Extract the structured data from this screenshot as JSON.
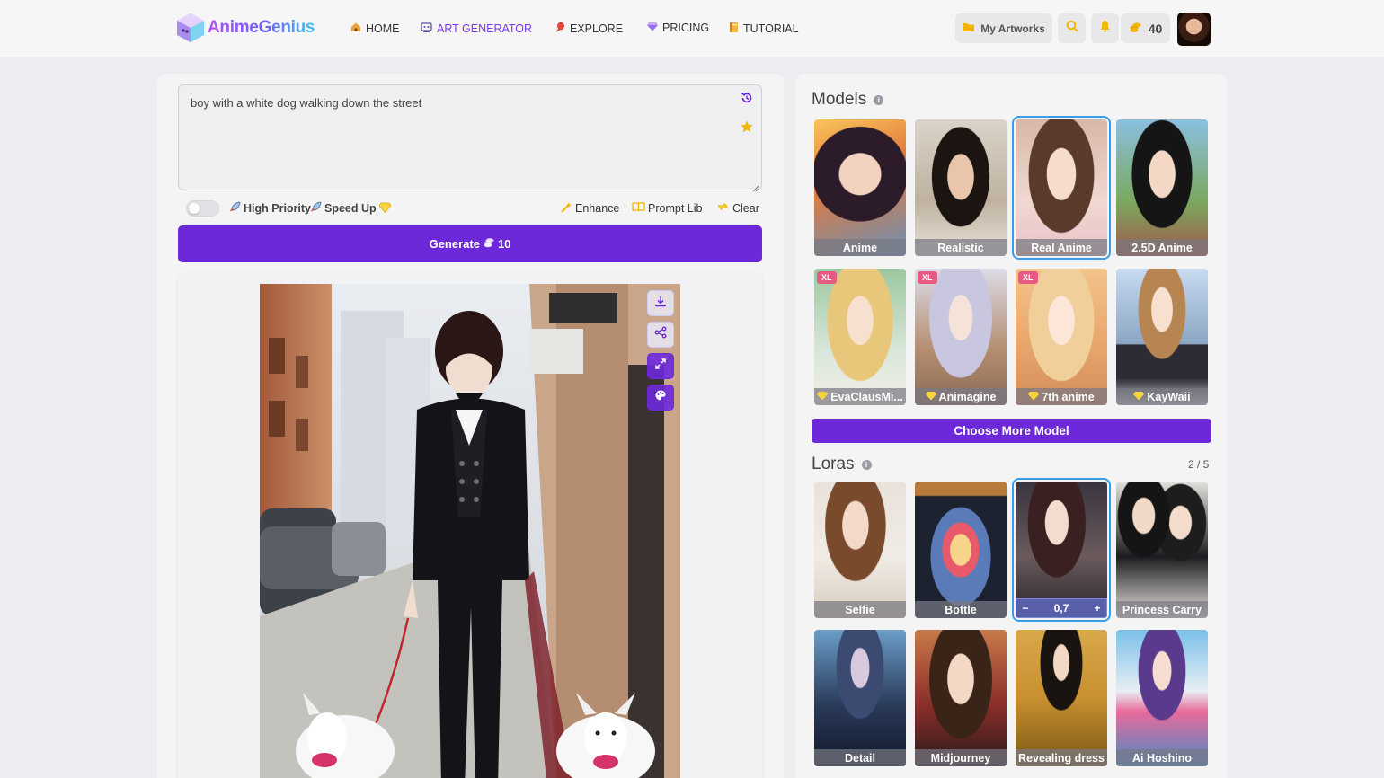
{
  "header": {
    "logo_text": "AnimeGenius",
    "nav": [
      {
        "label": "HOME",
        "icon": "home-icon"
      },
      {
        "label": "ART GENERATOR",
        "icon": "art-icon"
      },
      {
        "label": "EXPLORE",
        "icon": "explore-icon"
      },
      {
        "label": "PRICING",
        "icon": "diamond-icon"
      },
      {
        "label": "TUTORIAL",
        "icon": "book-icon"
      }
    ],
    "my_artworks": "My Artworks",
    "coins": "40"
  },
  "prompt": {
    "text": "boy with a white dog walking down the street"
  },
  "options": {
    "high_priority": "High Priority",
    "speed_up": "Speed Up",
    "enhance": "Enhance",
    "prompt_lib": "Prompt Lib",
    "clear": "Clear"
  },
  "generate": {
    "label": "Generate",
    "cost": "10"
  },
  "models": {
    "title": "Models",
    "items": [
      {
        "label": "Anime"
      },
      {
        "label": "Realistic"
      },
      {
        "label": "Real Anime"
      },
      {
        "label": "2.5D Anime"
      },
      {
        "label": "EvaClausMi...",
        "badge": "XL"
      },
      {
        "label": "Animagine",
        "badge": "XL"
      },
      {
        "label": "7th anime",
        "badge": "XL"
      },
      {
        "label": "KayWaii"
      }
    ],
    "more_button": "Choose More Model"
  },
  "loras": {
    "title": "Loras",
    "count": "2 / 5",
    "items": [
      {
        "label": "Selfie"
      },
      {
        "label": "Bottle"
      },
      {
        "label": "",
        "weight": "0,7"
      },
      {
        "label": "Princess Carry"
      },
      {
        "label": "Detail"
      },
      {
        "label": "Midjourney"
      },
      {
        "label": "Revealing dress"
      },
      {
        "label": "Ai Hoshino"
      }
    ]
  },
  "colors": {
    "accent": "#6d28d9",
    "active_nav": "#7c3aed",
    "selected_outline": "#3b9ce8",
    "gold": "#f2b705"
  }
}
